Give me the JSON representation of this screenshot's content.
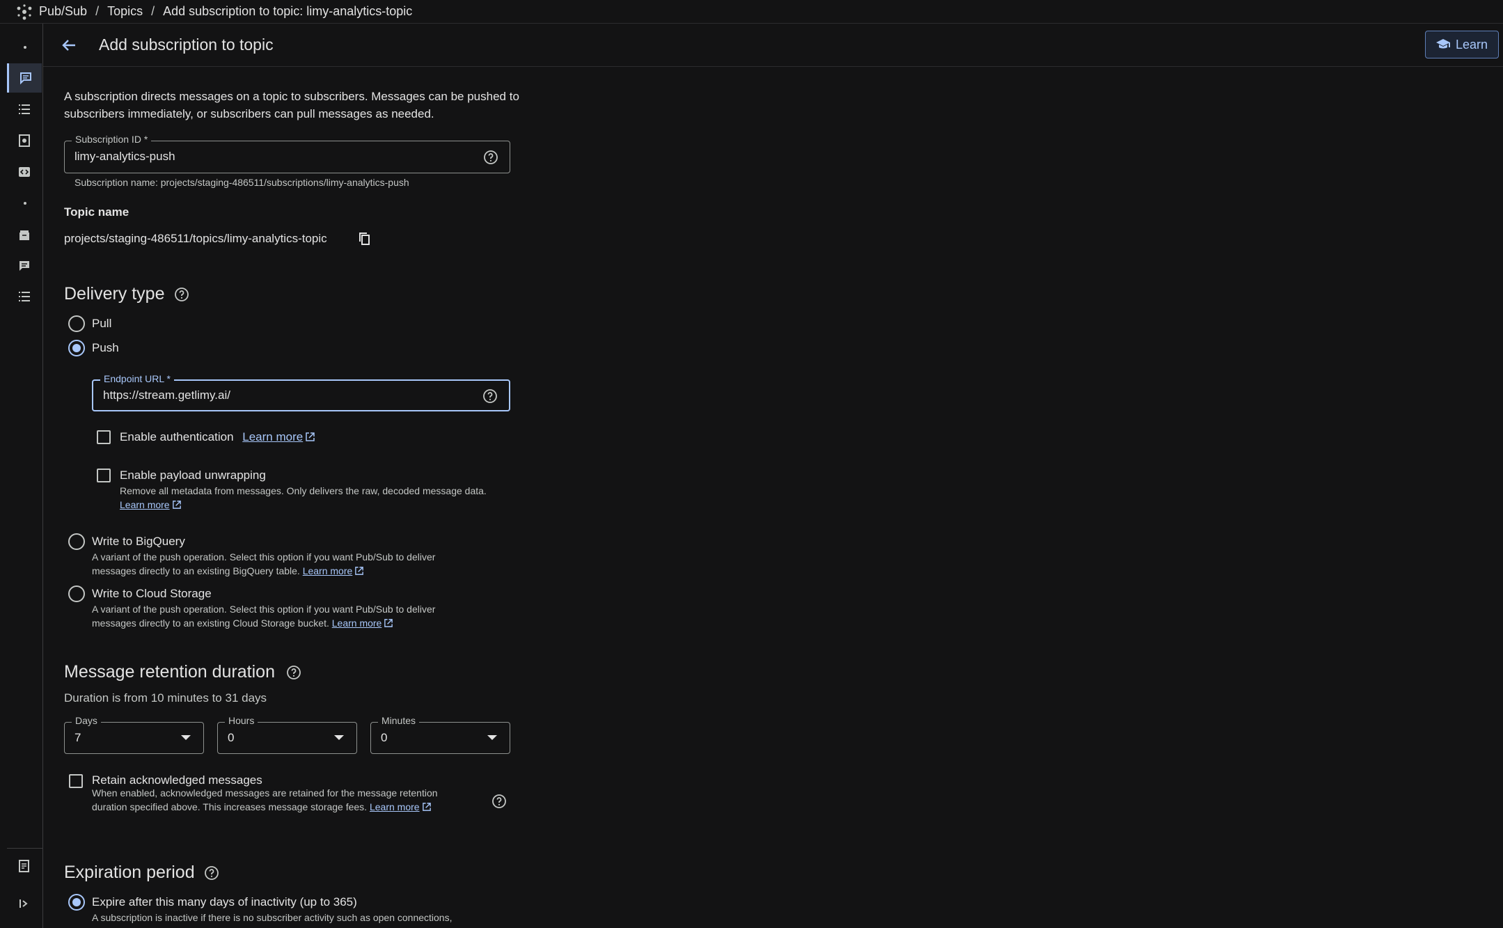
{
  "breadcrumb": {
    "items": [
      "Pub/Sub",
      "Topics",
      "Add subscription to topic: limy-analytics-topic"
    ],
    "separator": "/"
  },
  "header": {
    "title": "Add subscription to topic",
    "learn_label": "Learn"
  },
  "intro": "A subscription directs messages on a topic to subscribers. Messages can be pushed to subscribers immediately, or subscribers can pull messages as needed.",
  "subscription_id": {
    "label": "Subscription ID *",
    "value": "limy-analytics-push",
    "hint": "Subscription name: projects/staging-486511/subscriptions/limy-analytics-push"
  },
  "topic": {
    "label": "Topic name",
    "value": "projects/staging-486511/topics/limy-analytics-topic"
  },
  "delivery": {
    "title": "Delivery type",
    "pull_label": "Pull",
    "push_label": "Push",
    "endpoint_label": "Endpoint URL *",
    "endpoint_value": "https://stream.getlimy.ai/",
    "auth_label": "Enable authentication",
    "auth_learn": "Learn more",
    "unwrap_label": "Enable payload unwrapping",
    "unwrap_desc": "Remove all metadata from messages. Only delivers the raw, decoded message data.",
    "unwrap_learn": "Learn more",
    "bq_label": "Write to BigQuery",
    "bq_desc_1": "A variant of the push operation. Select this option if you want Pub/Sub to deliver",
    "bq_desc_2": "messages directly to an existing BigQuery table.",
    "bq_learn": "Learn more",
    "gcs_label": "Write to Cloud Storage",
    "gcs_desc_1": "A variant of the push operation. Select this option if you want Pub/Sub to deliver",
    "gcs_desc_2": "messages directly to an existing Cloud Storage bucket.",
    "gcs_learn": "Learn more",
    "selected": "Push"
  },
  "retention": {
    "title": "Message retention duration",
    "subtitle": "Duration is from 10 minutes to 31 days",
    "days_label": "Days",
    "days_value": "7",
    "hours_label": "Hours",
    "hours_value": "0",
    "minutes_label": "Minutes",
    "minutes_value": "0",
    "retain_label": "Retain acknowledged messages",
    "retain_desc_1": "When enabled, acknowledged messages are retained for the message retention",
    "retain_desc_2": "duration specified above. This increases message storage fees.",
    "retain_learn": "Learn more"
  },
  "expiration": {
    "title": "Expiration period",
    "expire_label": "Expire after this many days of inactivity (up to 365)",
    "expire_desc": "A subscription is inactive if there is no subscriber activity such as open connections,"
  },
  "colors": {
    "background": "#131314",
    "accent": "#a8c7fa",
    "text": "#e3e3e3",
    "muted": "#c4c7c5"
  }
}
